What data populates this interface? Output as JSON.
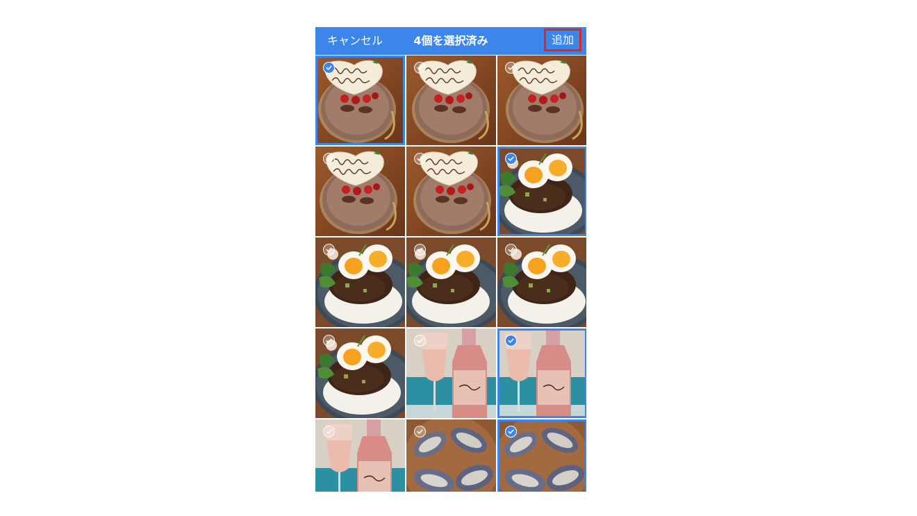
{
  "navbar": {
    "cancel_label": "キャンセル",
    "title": "4個を選択済み",
    "add_label": "追加",
    "background_color": "#3b86e8",
    "highlight_color": "#e0271f"
  },
  "photos": [
    {
      "subject": "birthday-cake",
      "selected": true,
      "caption": "Happy Birthday"
    },
    {
      "subject": "birthday-cake",
      "selected": false,
      "caption": "Happy Birthday"
    },
    {
      "subject": "birthday-cake",
      "selected": false,
      "caption": "Happy Birthday"
    },
    {
      "subject": "birthday-cake",
      "selected": false,
      "caption": "Happy Birthday"
    },
    {
      "subject": "birthday-cake",
      "selected": false,
      "caption": "Happy Birthday"
    },
    {
      "subject": "egg-curry",
      "selected": true
    },
    {
      "subject": "egg-curry",
      "selected": false
    },
    {
      "subject": "egg-curry",
      "selected": false
    },
    {
      "subject": "egg-curry",
      "selected": false
    },
    {
      "subject": "egg-curry",
      "selected": false
    },
    {
      "subject": "wine-glass",
      "selected": false
    },
    {
      "subject": "wine-glass",
      "selected": true
    },
    {
      "subject": "wine-glass",
      "selected": false
    },
    {
      "subject": "shellfish",
      "selected": false
    },
    {
      "subject": "shellfish",
      "selected": true
    }
  ],
  "check_icon": "checkmark-icon",
  "selection_color": "#3b86e8"
}
